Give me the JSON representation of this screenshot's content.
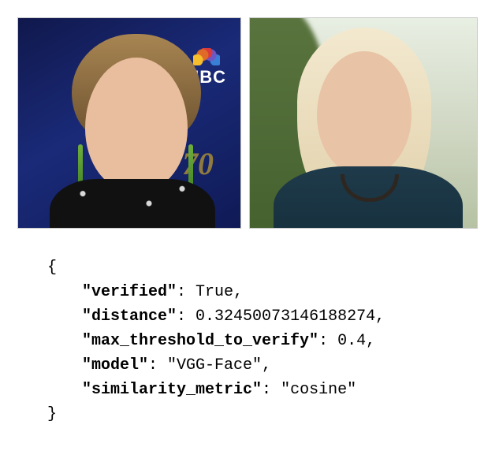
{
  "json_output": {
    "open_brace": "{",
    "close_brace": "}",
    "keys": {
      "verified": "\"verified\"",
      "distance": "\"distance\"",
      "max_threshold_to_verify": "\"max_threshold_to_verify\"",
      "model": "\"model\"",
      "similarity_metric": "\"similarity_metric\""
    },
    "values": {
      "verified": "True",
      "distance": "0.32450073146188274",
      "max_threshold_to_verify": "0.4",
      "model": "\"VGG-Face\"",
      "similarity_metric": "\"cosine\""
    },
    "colon": ": ",
    "comma": ","
  },
  "logo_text": "NBC",
  "anniversary_text": "70"
}
